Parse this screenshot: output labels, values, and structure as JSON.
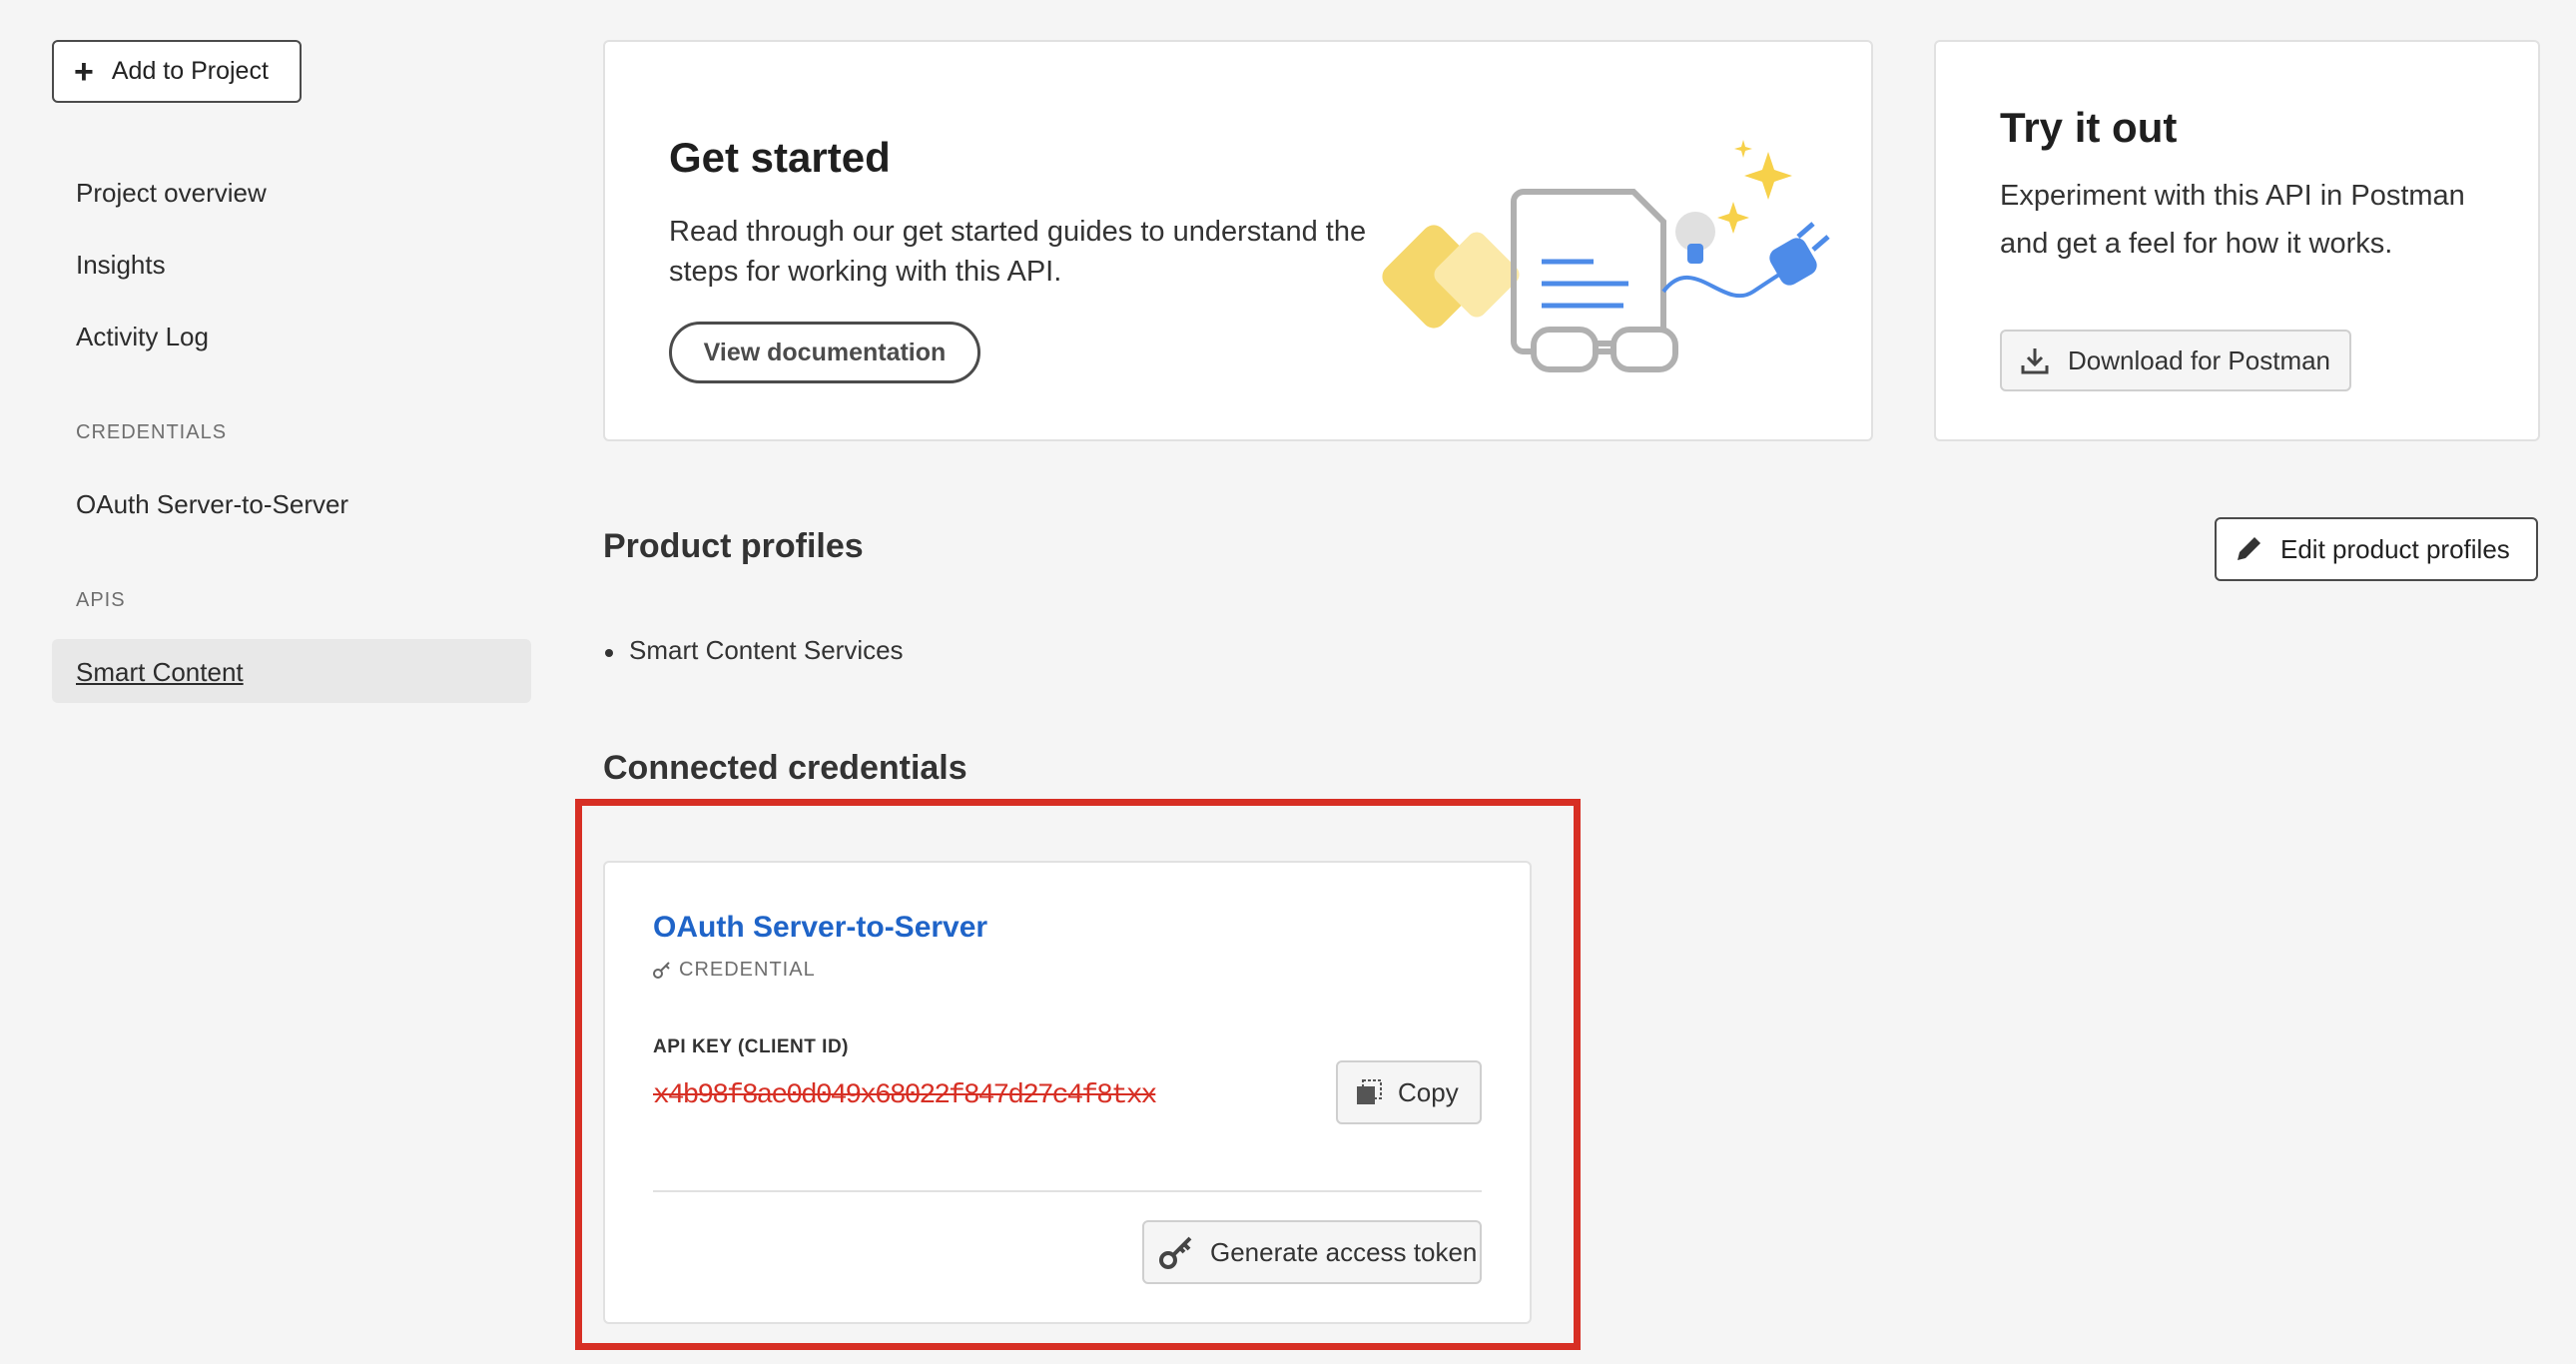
{
  "sidebar": {
    "add_button_label": "Add to Project",
    "items": [
      {
        "label": "Project overview"
      },
      {
        "label": "Insights"
      },
      {
        "label": "Activity Log"
      }
    ],
    "credentials_section": "CREDENTIALS",
    "credentials_items": [
      {
        "label": "OAuth Server-to-Server"
      }
    ],
    "apis_section": "APIS",
    "apis_items": [
      {
        "label": "Smart Content",
        "selected": true
      }
    ]
  },
  "get_started": {
    "title": "Get started",
    "description": "Read through our get started guides to understand the steps for working with this API.",
    "button_label": "View documentation"
  },
  "try_it_out": {
    "title": "Try it out",
    "description": "Experiment with this API in Postman and get a feel for how it works.",
    "button_label": "Download for Postman"
  },
  "product_profiles": {
    "title": "Product profiles",
    "edit_button_label": "Edit product profiles",
    "items": [
      "Smart Content Services"
    ]
  },
  "connected_credentials": {
    "title": "Connected credentials",
    "credential": {
      "name": "OAuth Server-to-Server",
      "type_label": "CREDENTIAL",
      "api_key_label": "API KEY (CLIENT ID)",
      "api_key_value": "x4b98f8ae0d049x68022f847d27c4f8txx",
      "copy_label": "Copy",
      "generate_token_label": "Generate access token"
    },
    "highlight_color": "#d72f24"
  }
}
